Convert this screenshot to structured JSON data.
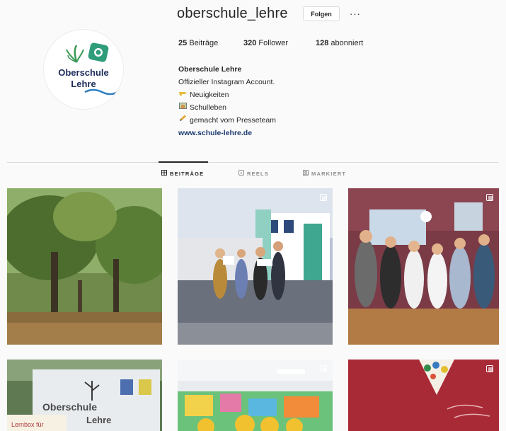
{
  "profile": {
    "username": "oberschule_lehre",
    "follow_label": "Folgen",
    "more_label": "···",
    "logo_line1": "Oberschule",
    "logo_line2": "Lehre",
    "stats": {
      "posts_count": "25",
      "posts_label": "Beiträge",
      "followers_count": "320",
      "followers_label": "Follower",
      "following_count": "128",
      "following_label": "abonniert"
    },
    "bio": {
      "name": "Oberschule Lehre",
      "line1": "Offizieller Instagram Account.",
      "line2_icon": "pointing-hand-icon",
      "line2": "Neuigkeiten",
      "line3_icon": "school-photo-icon",
      "line3": "Schulleben",
      "line4_icon": "pencil-icon",
      "line4": "gemacht vom Presseteam",
      "link": "www.schule-lehre.de"
    }
  },
  "tabs": [
    {
      "label": "BEITRÄGE",
      "active": true
    },
    {
      "label": "REELS",
      "active": false
    },
    {
      "label": "MARKIERT",
      "active": false
    }
  ],
  "colors": {
    "background": "#fafafa",
    "text": "#262626",
    "muted": "#8e8e8e",
    "border": "#dbdbdb",
    "link": "#1c3a6e",
    "logo_green": "#3a9a56",
    "logo_blue": "#1d2c5a"
  },
  "posts": [
    {
      "name": "post-trees",
      "multi": false
    },
    {
      "name": "post-award-ceremony",
      "multi": true
    },
    {
      "name": "post-classroom-group",
      "multi": true
    },
    {
      "name": "post-school-sign",
      "multi": false
    },
    {
      "name": "post-decorated-room",
      "multi": true
    },
    {
      "name": "post-red-heart-art",
      "multi": true
    }
  ]
}
